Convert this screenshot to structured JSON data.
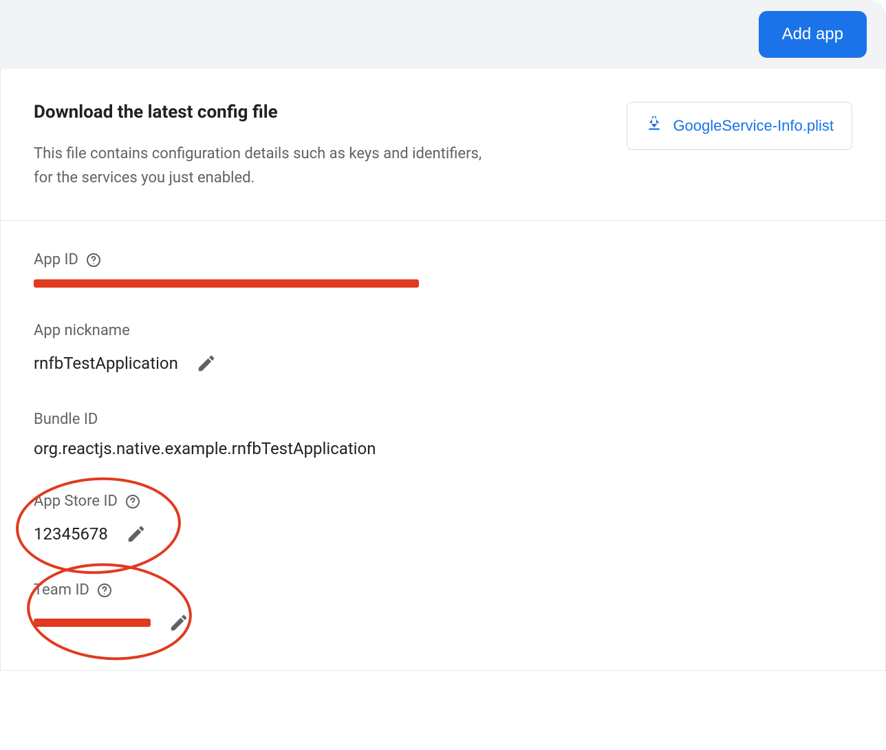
{
  "header": {
    "add_app_label": "Add app"
  },
  "config": {
    "heading": "Download the latest config file",
    "description": "This file contains configuration details such as keys and identifiers, for the services you just enabled.",
    "download_label": "GoogleService-Info.plist"
  },
  "fields": {
    "app_id": {
      "label": "App ID",
      "value_redacted": true
    },
    "app_nickname": {
      "label": "App nickname",
      "value": "rnfbTestApplication"
    },
    "bundle_id": {
      "label": "Bundle ID",
      "value": "org.reactjs.native.example.rnfbTestApplication"
    },
    "app_store_id": {
      "label": "App Store ID",
      "value": "12345678"
    },
    "team_id": {
      "label": "Team ID",
      "value_redacted": true
    }
  }
}
